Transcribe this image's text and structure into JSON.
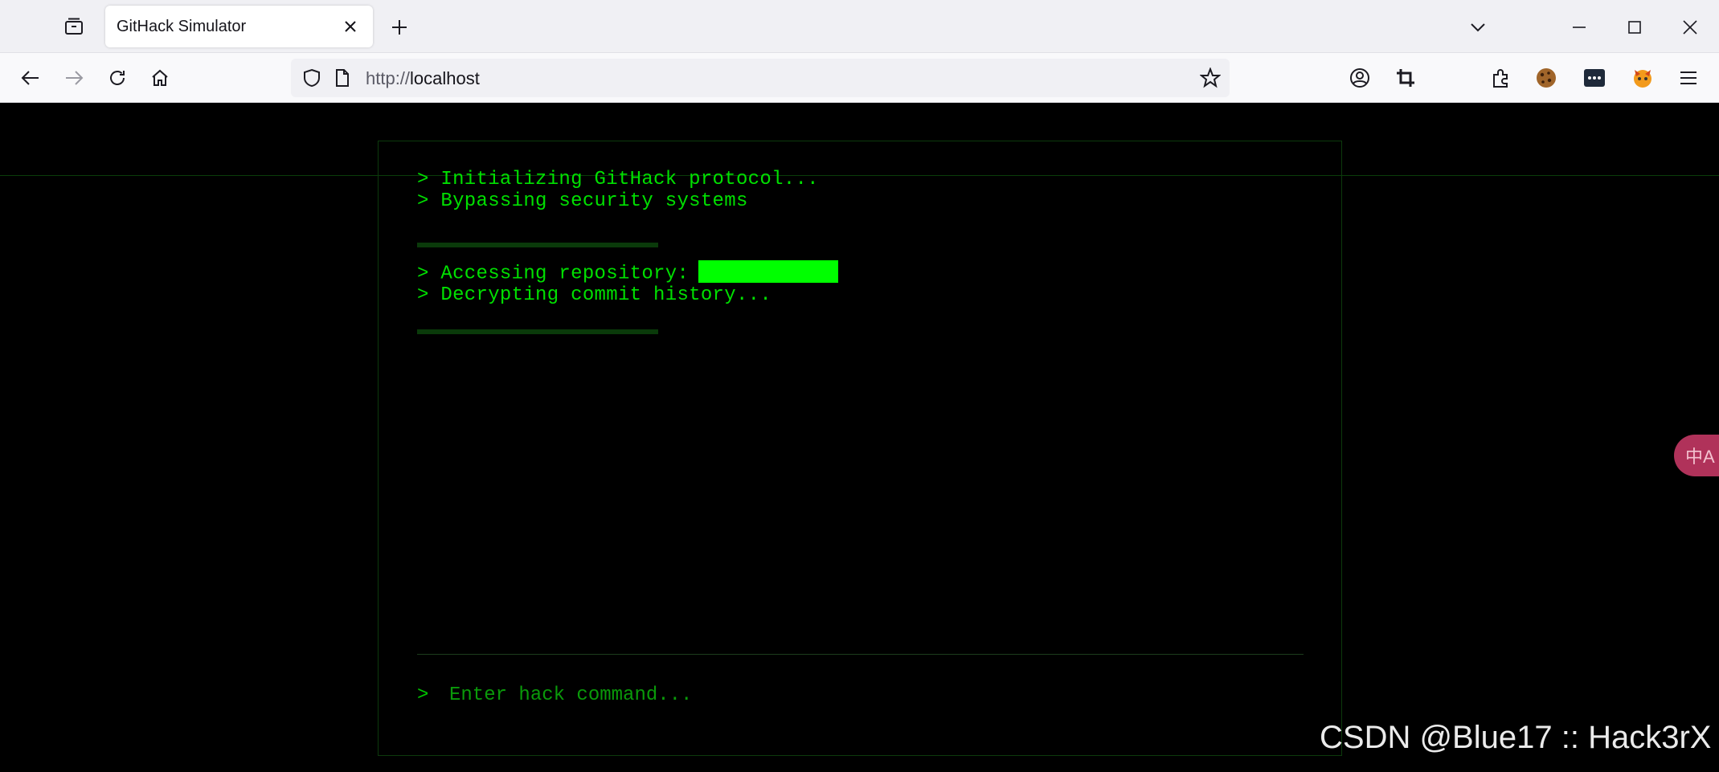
{
  "browser": {
    "tab_title": "GitHack Simulator",
    "url_protocol": "http://",
    "url_host": "localhost"
  },
  "terminal": {
    "lines_block1": [
      "> Initializing GitHack protocol...",
      "> Bypassing security systems"
    ],
    "line_repo_label": "> Accessing repository:",
    "line_decrypt": "> Decrypting commit history...",
    "prompt_symbol": ">",
    "input_placeholder": "Enter hack command...",
    "colors": {
      "text": "#00e000",
      "highlight": "#00ff00",
      "background": "#000000"
    }
  },
  "translate_button": {
    "label": "中A"
  },
  "watermark": "CSDN @Blue17 :: Hack3rX"
}
